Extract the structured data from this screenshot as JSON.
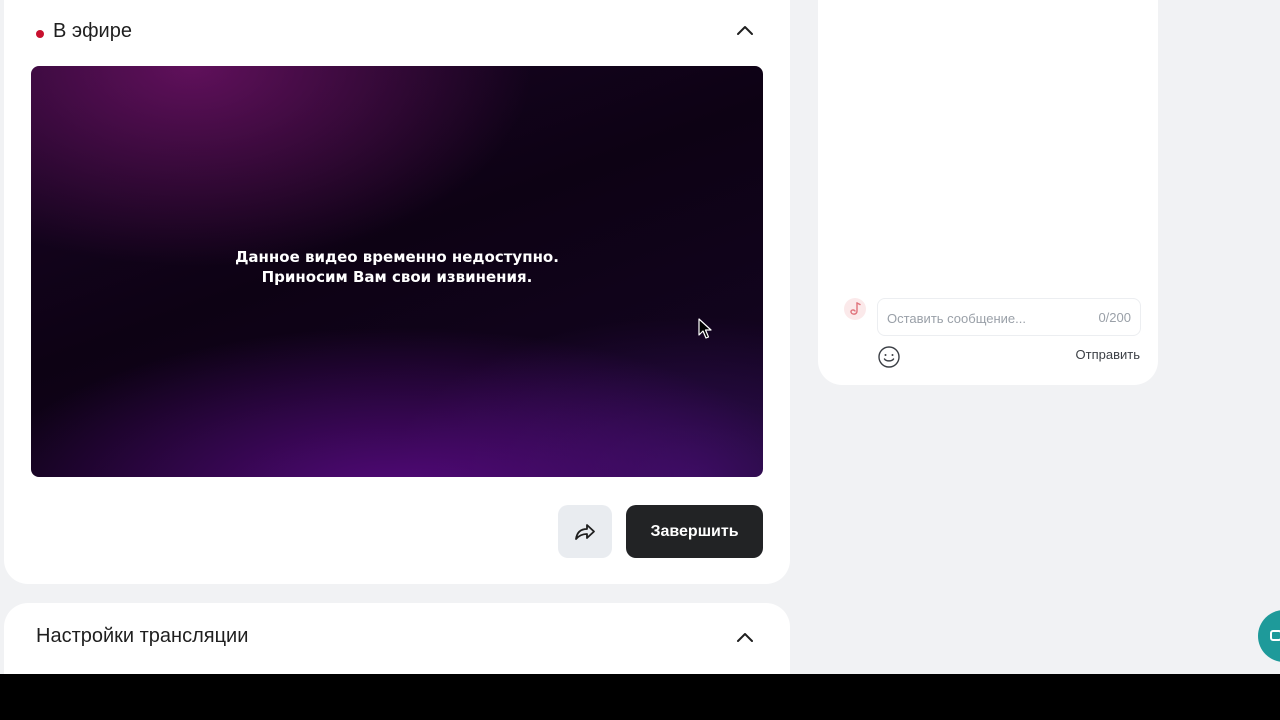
{
  "live": {
    "title": "В эфире",
    "live_color": "#c8102e"
  },
  "video": {
    "message_line1": "Данное видео временно недоступно.",
    "message_line2": "Приносим Вам свои извинения."
  },
  "actions": {
    "share_icon": "share-arrow-icon",
    "finish_label": "Завершить"
  },
  "settings": {
    "title": "Настройки трансляции"
  },
  "chat": {
    "input_placeholder": "Оставить сообщение...",
    "counter": "0/200",
    "emoji_icon": "smiley-icon",
    "send_label": "Отправить"
  },
  "colors": {
    "background": "#f1f2f4",
    "card": "#ffffff",
    "primary_button": "#222325",
    "widget": "#1e9a9a"
  }
}
